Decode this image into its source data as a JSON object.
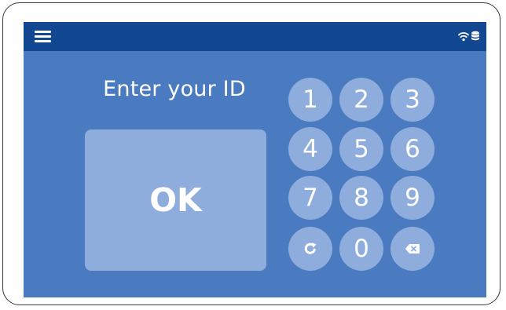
{
  "app": {
    "prompt": "Enter your ID",
    "ok_label": "OK"
  },
  "header": {
    "menu_icon": "hamburger-menu-icon",
    "status_icons": [
      "wifi-icon",
      "database-icon"
    ]
  },
  "keypad": {
    "keys": [
      {
        "label": "1"
      },
      {
        "label": "2"
      },
      {
        "label": "3"
      },
      {
        "label": "4"
      },
      {
        "label": "5"
      },
      {
        "label": "6"
      },
      {
        "label": "7"
      },
      {
        "label": "8"
      },
      {
        "label": "9"
      },
      {
        "icon": "refresh-icon"
      },
      {
        "label": "0"
      },
      {
        "icon": "backspace-icon"
      }
    ]
  },
  "colors": {
    "header_bg": "#124891",
    "screen_bg": "#4a7bc0",
    "button_bg": "#8eaddc",
    "text": "#ffffff"
  }
}
